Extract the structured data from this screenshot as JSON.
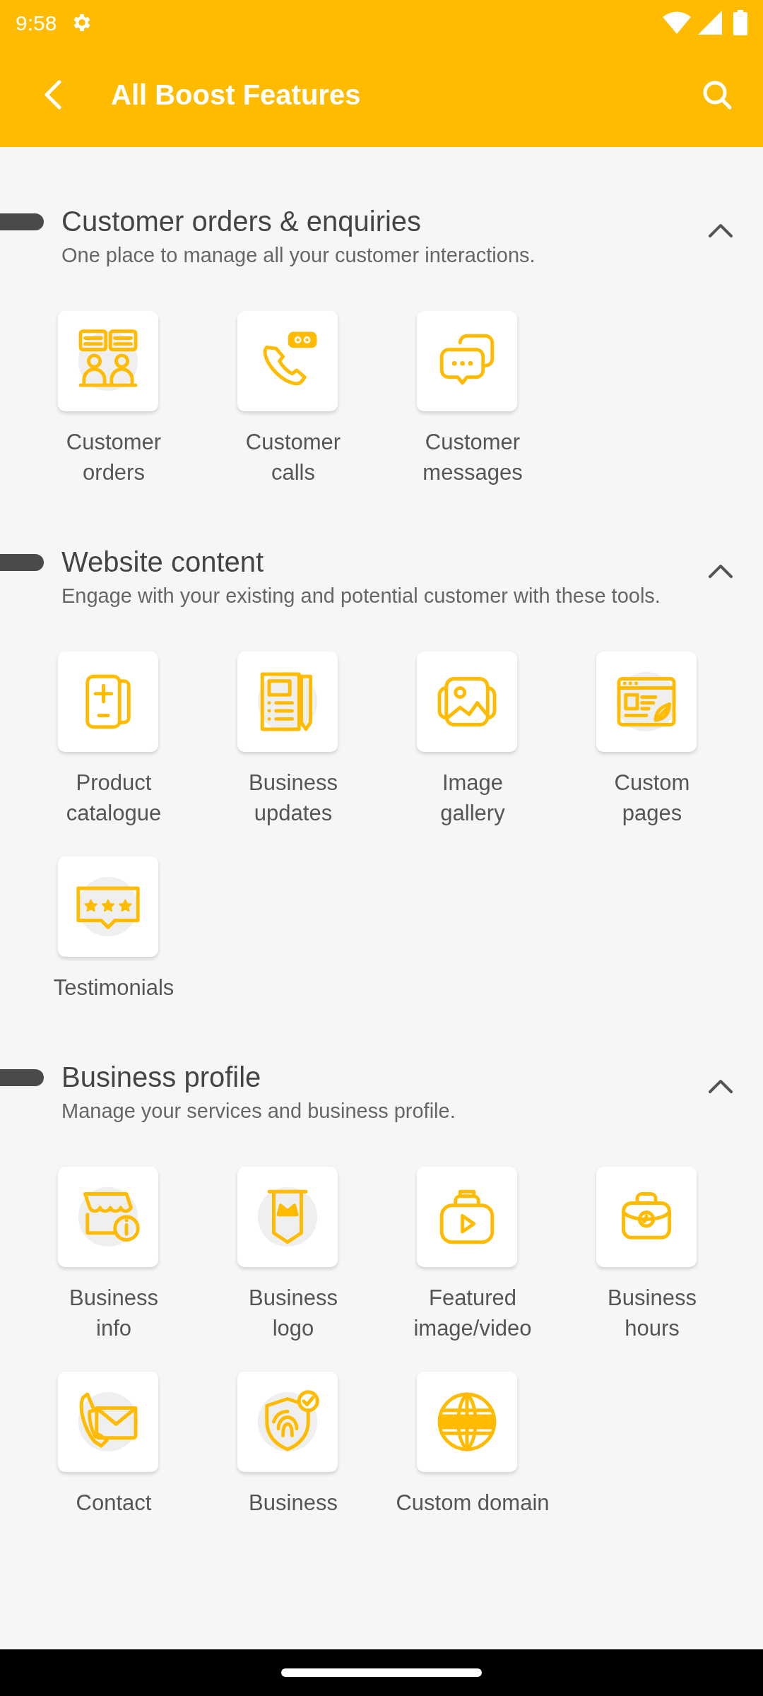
{
  "status_bar": {
    "time": "9:58"
  },
  "app_bar": {
    "title": "All Boost Features"
  },
  "sections": [
    {
      "title": "Customer orders & enquiries",
      "subtitle": "One place to manage all your customer interactions.",
      "expanded": true,
      "features": [
        {
          "label": "Customer\norders"
        },
        {
          "label": "Customer\ncalls"
        },
        {
          "label": "Customer\nmessages"
        }
      ]
    },
    {
      "title": "Website content",
      "subtitle": "Engage with your existing and potential customer with these tools.",
      "expanded": true,
      "features": [
        {
          "label": "Product\ncatalogue"
        },
        {
          "label": "Business\nupdates"
        },
        {
          "label": "Image\ngallery"
        },
        {
          "label": "Custom\npages"
        },
        {
          "label": "Testimonials"
        }
      ]
    },
    {
      "title": "Business profile",
      "subtitle": "Manage your services and business profile.",
      "expanded": true,
      "features": [
        {
          "label": "Business\ninfo"
        },
        {
          "label": "Business\nlogo"
        },
        {
          "label": "Featured\nimage/video"
        },
        {
          "label": "Business\nhours"
        },
        {
          "label": "Contact"
        },
        {
          "label": "Business"
        },
        {
          "label": "Custom domain"
        }
      ]
    }
  ]
}
